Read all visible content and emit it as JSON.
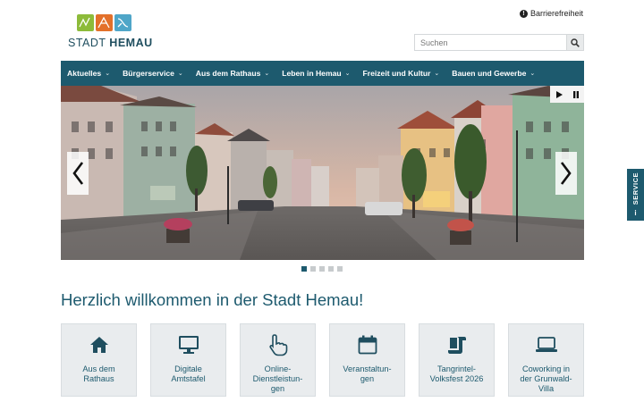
{
  "header": {
    "logo_text_light": "STADT ",
    "logo_text_bold": "HEMAU",
    "accessibility_label": "Barrierefreiheit",
    "search_placeholder": "Suchen"
  },
  "nav": {
    "items": [
      {
        "label": "Aktuelles"
      },
      {
        "label": "Bürgerservice"
      },
      {
        "label": "Aus dem Rathaus"
      },
      {
        "label": "Leben in Hemau"
      },
      {
        "label": "Freizeit und Kultur"
      },
      {
        "label": "Bauen und Gewerbe"
      }
    ]
  },
  "slider": {
    "play_icon": "play-icon",
    "pause_icon": "pause-icon",
    "slide_count": 5,
    "active_slide": 1
  },
  "service_tab": {
    "label": "SERVICE",
    "info": "i"
  },
  "main": {
    "heading": "Herzlich willkommen in der Stadt Hemau!",
    "tiles": [
      {
        "icon": "home-icon",
        "label": "Aus dem\nRathaus"
      },
      {
        "icon": "monitor-icon",
        "label": "Digitale\nAmtstafel"
      },
      {
        "icon": "hand-pointer-icon",
        "label": "Online-\nDienstleistun-\ngen"
      },
      {
        "icon": "calendar-icon",
        "label": "Veranstaltun-\ngen"
      },
      {
        "icon": "scroll-icon",
        "label": "Tangrintel-\nVolksfest 2026"
      },
      {
        "icon": "laptop-icon",
        "label": "Coworking in\nder Grunwald-\nVilla"
      }
    ]
  },
  "colors": {
    "primary": "#1d5a6e",
    "tile_bg": "#e9ecee",
    "logo_green": "#8dbb3a",
    "logo_orange": "#e3702a",
    "logo_blue": "#4fa6c8"
  }
}
